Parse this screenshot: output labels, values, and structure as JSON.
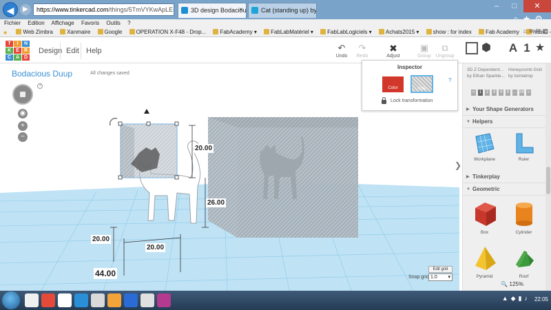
{
  "browser": {
    "url_host": "https://www.tinkercad.com",
    "url_path": "/things/5TmVYKwApLE-bodacio",
    "tabs": [
      {
        "label": "3D design Bodacious Duup ...",
        "active": true
      },
      {
        "label": "Cat (standing up) by Scintilla - Thingiverse",
        "active": false
      }
    ],
    "window_controls": {
      "minimize": "–",
      "maximize": "□",
      "close": "✕"
    },
    "menu": [
      "Fichier",
      "Edition",
      "Affichage",
      "Favoris",
      "Outils",
      "?"
    ],
    "favorites": [
      {
        "label": "Web Zimbra"
      },
      {
        "label": "Xanmaire"
      },
      {
        "label": "Google"
      },
      {
        "label": "OPERATION X-F48 - Drop..."
      },
      {
        "label": "FabAcademy"
      },
      {
        "label": "FabLabMatériel"
      },
      {
        "label": "FabLabLogiciels"
      },
      {
        "label": "Achats2015"
      },
      {
        "label": "show : for index"
      },
      {
        "label": "Fab Academy"
      },
      {
        "label": "hubiC - OVH"
      }
    ],
    "zoom_level": "125%"
  },
  "toolbar": {
    "logo_letters": [
      "TIN",
      "KER",
      "CAD"
    ],
    "logo_colors": [
      "#e5473b",
      "#f29b2f",
      "#3b8fd1",
      "#5ab04f",
      "#e5473b",
      "#f29b2f",
      "#3b8fd1",
      "#5ab04f",
      "#e5473b"
    ],
    "nav": [
      "Design",
      "Edit",
      "Help"
    ],
    "undo_label": "Undo",
    "redo_label": "Redo",
    "adjust_label": "Adjust",
    "group_label": "Group",
    "ungroup_label": "Ungroup",
    "view_a": "A",
    "view_1": "1"
  },
  "design": {
    "title": "Bodacious Duup",
    "save_status": "All changes saved"
  },
  "dimensions": {
    "box_height": "20.00",
    "cat_height": "26.00",
    "depth": "20.00",
    "width": "20.00",
    "length": "44.00"
  },
  "inspector": {
    "title": "Inspector",
    "color_label": "Color",
    "hole_label": "Hole",
    "help": "?",
    "lock_label": "Lock transformation"
  },
  "grid": {
    "edit_grid_label": "Edit grid",
    "snap_label": "Snap grid",
    "snap_value": "1.0"
  },
  "right_panel": {
    "community": [
      {
        "line1": "3D Z Dependent...",
        "line2": "by Ethan Sparkle..."
      },
      {
        "line1": "Honeycomb Grid",
        "line2": "by tomlatrop"
      }
    ],
    "pager": [
      "«",
      "1",
      "2",
      "3",
      "4",
      "5",
      "...",
      "26",
      "»"
    ],
    "sections": [
      "Your Shape Generators",
      "Helpers",
      "Tinkerplay",
      "Geometric"
    ],
    "helpers": [
      "Workplane",
      "Ruler"
    ],
    "geometric": [
      "Box",
      "Cylinder",
      "Pyramid",
      "Roof"
    ]
  },
  "taskbar": {
    "clock": "22:05"
  }
}
